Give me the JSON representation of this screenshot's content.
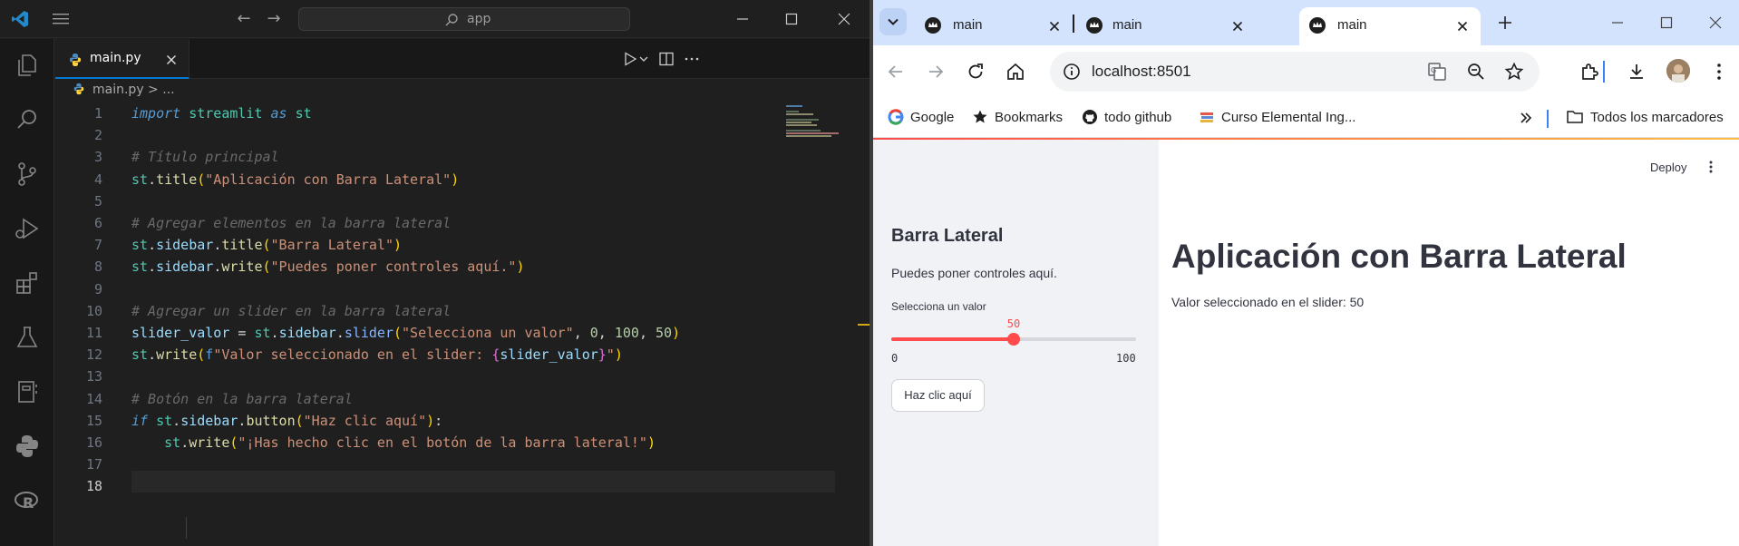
{
  "vscode": {
    "search_text": "app",
    "tab": {
      "label": "main.py"
    },
    "breadcrumb": {
      "file": "main.py",
      "rest": " > ..."
    },
    "lines": [
      {
        "n": "1",
        "tokens": [
          [
            "kw",
            "import"
          ],
          [
            "",
            "  "
          ],
          [
            "mod",
            "streamlit"
          ],
          [
            "",
            ""
          ],
          [
            "kw",
            " as"
          ],
          [
            "",
            "  "
          ],
          [
            "mod",
            "st"
          ]
        ]
      },
      {
        "n": "2",
        "tokens": []
      },
      {
        "n": "3",
        "tokens": [
          [
            "cm",
            "# Título principal"
          ]
        ]
      },
      {
        "n": "4",
        "tokens": [
          [
            "mod",
            "st"
          ],
          [
            "",
            "."
          ],
          [
            "fn",
            "title"
          ],
          [
            "pun",
            "("
          ],
          [
            "str",
            "\"Aplicación con Barra Lateral\""
          ],
          [
            "pun",
            ")"
          ]
        ]
      },
      {
        "n": "5",
        "tokens": []
      },
      {
        "n": "6",
        "tokens": [
          [
            "cm",
            "# Agregar elementos en la barra lateral"
          ]
        ]
      },
      {
        "n": "7",
        "tokens": [
          [
            "mod",
            "st"
          ],
          [
            "",
            "."
          ],
          [
            "id",
            "sidebar"
          ],
          [
            "",
            "."
          ],
          [
            "fn",
            "title"
          ],
          [
            "pun",
            "("
          ],
          [
            "str",
            "\"Barra Lateral\""
          ],
          [
            "pun",
            ")"
          ]
        ]
      },
      {
        "n": "8",
        "tokens": [
          [
            "mod",
            "st"
          ],
          [
            "",
            "."
          ],
          [
            "id",
            "sidebar"
          ],
          [
            "",
            "."
          ],
          [
            "fn",
            "write"
          ],
          [
            "pun",
            "("
          ],
          [
            "str",
            "\"Puedes poner controles aquí.\""
          ],
          [
            "pun",
            ")"
          ]
        ]
      },
      {
        "n": "9",
        "tokens": []
      },
      {
        "n": "10",
        "tokens": [
          [
            "cm",
            "# Agregar un slider en la barra lateral"
          ]
        ]
      },
      {
        "n": "11",
        "tokens": [
          [
            "id",
            "slider_valor"
          ],
          [
            "",
            " = "
          ],
          [
            "mod",
            "st"
          ],
          [
            "",
            "."
          ],
          [
            "id",
            "sidebar"
          ],
          [
            "",
            "."
          ],
          [
            "fnb",
            "slider"
          ],
          [
            "pun",
            "("
          ],
          [
            "str",
            "\"Selecciona un valor\""
          ],
          [
            "",
            ", "
          ],
          [
            "num",
            "0"
          ],
          [
            "",
            ", "
          ],
          [
            "num",
            "100"
          ],
          [
            "",
            ", "
          ],
          [
            "num",
            "50"
          ],
          [
            "pun",
            ")"
          ]
        ]
      },
      {
        "n": "12",
        "tokens": [
          [
            "mod",
            "st"
          ],
          [
            "",
            "."
          ],
          [
            "fn",
            "write"
          ],
          [
            "pun",
            "("
          ],
          [
            "fstr",
            "f"
          ],
          [
            "str",
            "\"Valor seleccionado en el slider: "
          ],
          [
            "pun2",
            "{"
          ],
          [
            "id",
            "slider_valor"
          ],
          [
            "pun2",
            "}"
          ],
          [
            "str",
            "\""
          ],
          [
            "pun",
            ")"
          ]
        ]
      },
      {
        "n": "13",
        "tokens": []
      },
      {
        "n": "14",
        "tokens": [
          [
            "cm",
            "# Botón en la barra lateral"
          ]
        ]
      },
      {
        "n": "15",
        "tokens": [
          [
            "kw",
            "if"
          ],
          [
            "",
            " "
          ],
          [
            "mod",
            "st"
          ],
          [
            "",
            "."
          ],
          [
            "id",
            "sidebar"
          ],
          [
            "",
            "."
          ],
          [
            "fn",
            "button"
          ],
          [
            "pun",
            "("
          ],
          [
            "str",
            "\"Haz clic aquí\""
          ],
          [
            "pun",
            ")"
          ],
          [
            "",
            ":"
          ]
        ]
      },
      {
        "n": "16",
        "tokens": [
          [
            "",
            "    "
          ],
          [
            "mod",
            "st"
          ],
          [
            "",
            "."
          ],
          [
            "fn",
            "write"
          ],
          [
            "pun",
            "("
          ],
          [
            "str",
            "\"¡Has hecho clic en el botón de la barra lateral!\""
          ],
          [
            "pun",
            ")"
          ]
        ]
      },
      {
        "n": "17",
        "tokens": []
      },
      {
        "n": "18",
        "tokens": []
      }
    ]
  },
  "chrome": {
    "tabs": [
      {
        "label": "main"
      },
      {
        "label": "main"
      },
      {
        "label": "main"
      }
    ],
    "url": "localhost:8501",
    "bookmarks": [
      {
        "label": "Google",
        "icon": "google-icon"
      },
      {
        "label": "Bookmarks",
        "icon": "star-icon"
      },
      {
        "label": "todo github",
        "icon": "github-icon"
      },
      {
        "label": "Curso Elemental Ing...",
        "icon": "books-icon"
      }
    ],
    "all_bookmarks": "Todos los marcadores"
  },
  "streamlit": {
    "deploy": "Deploy",
    "sidebar_title": "Barra Lateral",
    "sidebar_text": "Puedes poner controles aquí.",
    "slider": {
      "label": "Selecciona un valor",
      "min": 0,
      "max": 100,
      "value": 50,
      "min_label": "0",
      "max_label": "100",
      "value_label": "50"
    },
    "button_label": "Haz clic aquí",
    "main_title": "Aplicación con Barra Lateral",
    "main_text": "Valor seleccionado en el slider: 50"
  },
  "colors": {
    "accent": "#ff4b4b",
    "vscode_blue": "#0078d4",
    "chrome_tabstrip": "#d3e3fd"
  }
}
